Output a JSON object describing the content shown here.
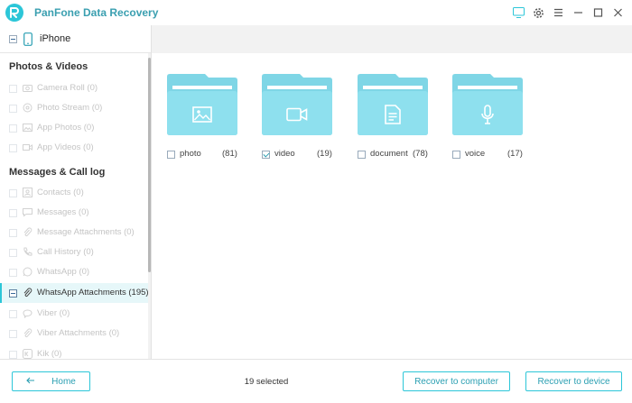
{
  "app": {
    "title": "PanFone Data Recovery",
    "accent_color": "#2cc6d8"
  },
  "window_controls": [
    {
      "icon": "feedback-icon"
    },
    {
      "icon": "gear-icon"
    },
    {
      "icon": "menu-icon"
    },
    {
      "icon": "minimize-icon"
    },
    {
      "icon": "maximize-icon"
    },
    {
      "icon": "close-icon"
    }
  ],
  "sidebar": {
    "device": {
      "name": "iPhone",
      "icon": "phone-icon"
    },
    "sections": [
      {
        "title": "Photos & Videos",
        "items": [
          {
            "label": "Camera Roll (0)",
            "icon": "camera-icon"
          },
          {
            "label": "Photo Stream (0)",
            "icon": "photo-stream-icon"
          },
          {
            "label": "App Photos (0)",
            "icon": "image-icon"
          },
          {
            "label": "App Videos (0)",
            "icon": "video-icon"
          }
        ]
      },
      {
        "title": "Messages & Call log",
        "items": [
          {
            "label": "Contacts (0)",
            "icon": "contacts-icon"
          },
          {
            "label": "Messages (0)",
            "icon": "messages-icon"
          },
          {
            "label": "Message Attachments (0)",
            "icon": "paperclip-icon"
          },
          {
            "label": "Call History (0)",
            "icon": "phone-call-icon"
          },
          {
            "label": "WhatsApp (0)",
            "icon": "whatsapp-icon"
          },
          {
            "label": "WhatsApp Attachments (195)",
            "icon": "paperclip-icon",
            "active": true
          },
          {
            "label": "Viber (0)",
            "icon": "viber-icon"
          },
          {
            "label": "Viber Attachments (0)",
            "icon": "paperclip-icon"
          },
          {
            "label": "Kik (0)",
            "icon": "kik-icon"
          }
        ]
      }
    ]
  },
  "folders": [
    {
      "name": "photo",
      "count": "(81)",
      "icon": "image-icon",
      "checked": false
    },
    {
      "name": "video",
      "count": "(19)",
      "icon": "video-icon",
      "checked": true
    },
    {
      "name": "document",
      "count": "(78)",
      "icon": "document-icon",
      "checked": false
    },
    {
      "name": "voice",
      "count": "(17)",
      "icon": "microphone-icon",
      "checked": false
    }
  ],
  "footer": {
    "home_label": "Home",
    "selected_text": "19 selected",
    "recover_computer_label": "Recover to computer",
    "recover_device_label": "Recover to device"
  }
}
